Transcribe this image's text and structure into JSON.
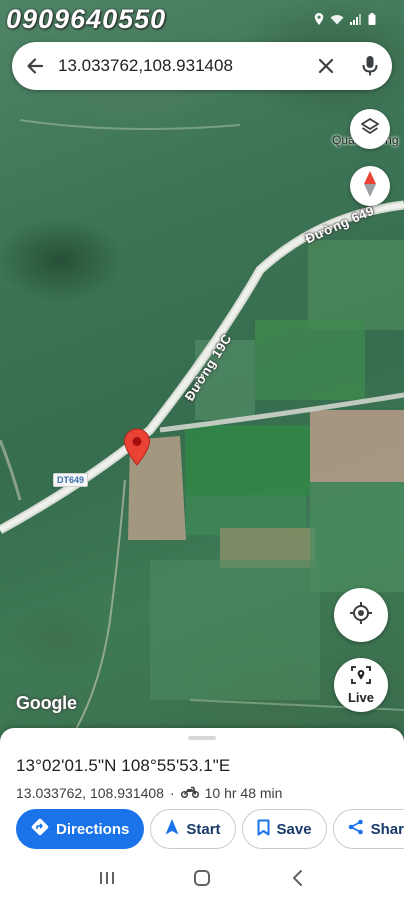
{
  "watermark": {
    "phone": "0909640550"
  },
  "search": {
    "query": "13.033762,108.931408"
  },
  "map": {
    "road_label_main": "Đường 19C",
    "road_label_ne": "Đường 649",
    "route_shield": "DT649",
    "place_label": "Quang Tông",
    "attribution": "Google"
  },
  "buttons": {
    "live_label": "Live"
  },
  "place": {
    "dms": "13°02'01.5\"N 108°55'53.1\"E",
    "decimal": "13.033762, 108.931408",
    "separator": "·",
    "travel_time": "10 hr 48 min",
    "travel_mode_icon": "motorcycle-icon"
  },
  "actions": [
    {
      "label": "Directions",
      "icon": "directions-icon"
    },
    {
      "label": "Start",
      "icon": "navigation-arrow-icon"
    },
    {
      "label": "Save",
      "icon": "bookmark-icon"
    },
    {
      "label": "Share",
      "icon": "share-icon"
    }
  ],
  "colors": {
    "accent": "#1a73e8",
    "pin": "#ea4335",
    "sheet": "#ffffff"
  }
}
